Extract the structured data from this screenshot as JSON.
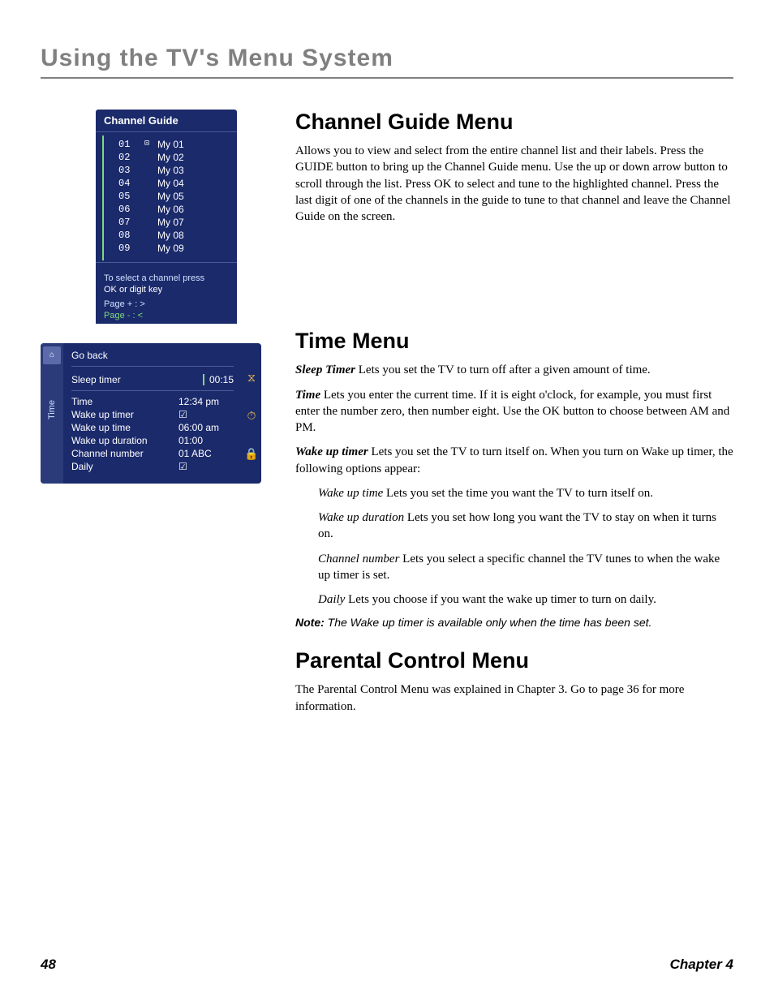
{
  "page_title": "Using the TV's Menu System",
  "channel_box": {
    "title": "Channel Guide",
    "rows": [
      {
        "n": "01",
        "icon": "⊡",
        "name": "My 01"
      },
      {
        "n": "02",
        "icon": "",
        "name": "My 02"
      },
      {
        "n": "03",
        "icon": "",
        "name": "My 03"
      },
      {
        "n": "04",
        "icon": "",
        "name": "My 04"
      },
      {
        "n": "05",
        "icon": "",
        "name": "My 05"
      },
      {
        "n": "06",
        "icon": "",
        "name": "My 06"
      },
      {
        "n": "07",
        "icon": "",
        "name": "My 07"
      },
      {
        "n": "08",
        "icon": "",
        "name": "My 08"
      },
      {
        "n": "09",
        "icon": "",
        "name": "My 09"
      }
    ],
    "help1": "To select a channel press",
    "help2": "OK or digit key",
    "help3": "Page + : >",
    "help4": "Page - : <"
  },
  "time_box": {
    "tab_label": "Time",
    "go_back": "Go back",
    "sleep_label": "Sleep timer",
    "sleep_value": "00:15",
    "rows": [
      {
        "l": "Time",
        "v": "12:34 pm"
      },
      {
        "l": "Wake up timer",
        "v": "☑"
      },
      {
        "l": "Wake up time",
        "v": "06:00 am"
      },
      {
        "l": "Wake up duration",
        "v": "01:00"
      },
      {
        "l": "Channel number",
        "v": "01 ABC"
      },
      {
        "l": "Daily",
        "v": "☑"
      }
    ],
    "icons": {
      "hourglass": "⧖",
      "clock": "⏱",
      "lock": "🔒"
    }
  },
  "body": {
    "h_channel": "Channel Guide Menu",
    "p_channel": "Allows you to view and select from the entire channel list and their labels. Press the GUIDE button to bring up the Channel Guide menu. Use the up or down arrow button to scroll through the list. Press OK to select and tune to the highlighted channel. Press the last digit of one of the channels in the guide to tune to that channel and leave the Channel Guide on the screen.",
    "h_time": "Time Menu",
    "sleep_timer_label": "Sleep Timer",
    "sleep_timer_text": "   Lets you set the TV to turn off after a given amount of time.",
    "time_label": "Time",
    "time_text": "   Lets you enter the current time. If it is eight o'clock, for example, you must first enter the number zero, then number eight. Use the OK button to choose between AM and PM.",
    "wake_label": "Wake up timer",
    "wake_text": "   Lets you set the TV to turn itself on. When you turn on Wake up timer, the following options appear:",
    "wut_label": "Wake up time",
    "wut_text": "   Lets you set the time you want the TV to turn itself on.",
    "wud_label": "Wake up duration",
    "wud_text": "   Lets you set how long you want the TV to stay on when it turns on.",
    "chn_label": "Channel number",
    "chn_text": "   Lets you select a specific channel the TV tunes to when the wake up timer is set.",
    "daily_label": "Daily",
    "daily_text": "   Lets you choose if you want the wake up timer to turn on daily.",
    "note_label": "Note:",
    "note_text": " The Wake up timer is available only when the time has been set.",
    "h_parental": "Parental Control Menu",
    "p_parental": "The Parental Control Menu was explained in Chapter 3. Go to page 36 for more information."
  },
  "footer": {
    "page": "48",
    "chapter": "Chapter 4"
  }
}
